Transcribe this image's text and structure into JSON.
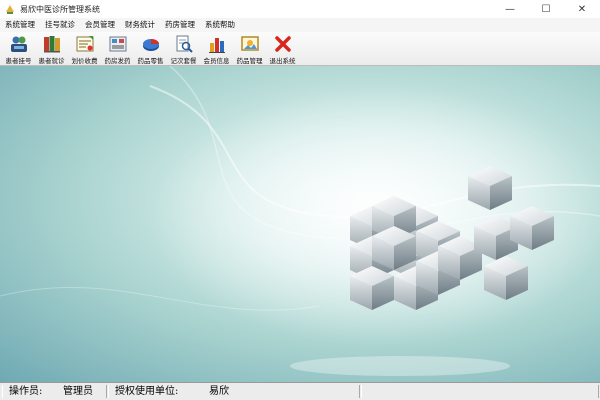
{
  "window": {
    "title": "易欣中医诊所管理系统",
    "minimize_glyph": "—",
    "maximize_glyph": "☐",
    "close_glyph": "✕"
  },
  "menu": {
    "items": [
      {
        "label": "系统管理"
      },
      {
        "label": "挂号就诊"
      },
      {
        "label": "会员管理"
      },
      {
        "label": "财务统计"
      },
      {
        "label": "药房管理"
      },
      {
        "label": "系统帮助"
      }
    ]
  },
  "toolbar": {
    "items": [
      {
        "label": "患者挂号",
        "icon": "patients-icon"
      },
      {
        "label": "患者就诊",
        "icon": "books-icon"
      },
      {
        "label": "划价收费",
        "icon": "certificate-icon"
      },
      {
        "label": "药房发药",
        "icon": "medicine-icon"
      },
      {
        "label": "药品零售",
        "icon": "pie-chart-icon"
      },
      {
        "label": "记次套餐",
        "icon": "search-document-icon"
      },
      {
        "label": "会员信息",
        "icon": "bar-chart-icon"
      },
      {
        "label": "药品管理",
        "icon": "picture-icon"
      },
      {
        "label": "退出系统",
        "icon": "exit-x-icon"
      }
    ]
  },
  "status": {
    "operator_label": "操作员:",
    "operator_value": "管理员",
    "unit_label": "授权使用单位:",
    "unit_value": "易欣"
  },
  "colors": {
    "accent_red": "#d8261c",
    "background_teal": "#a9d3cf"
  }
}
